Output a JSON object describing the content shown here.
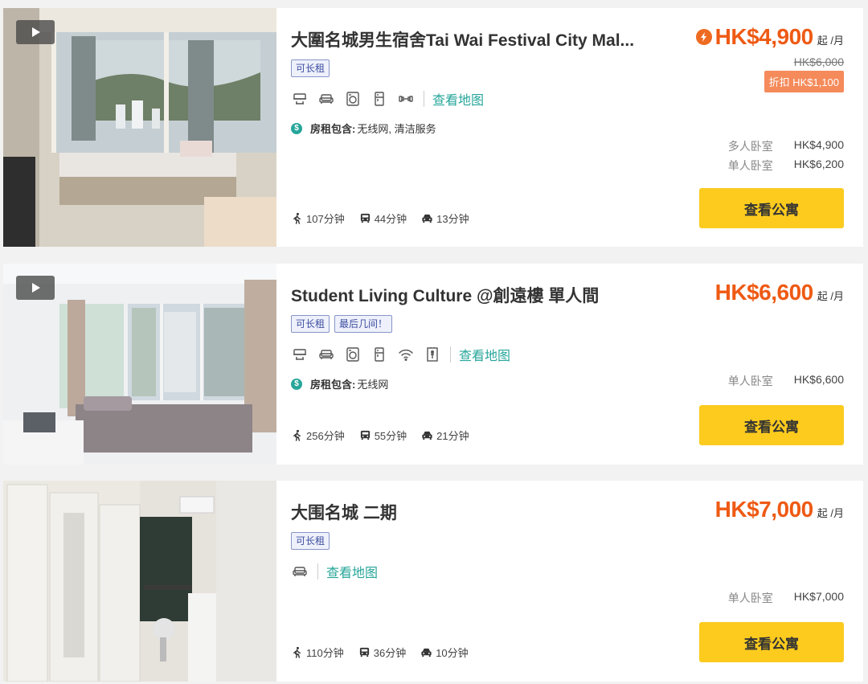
{
  "listings": [
    {
      "title": "大圍名城男生宿舍Tai Wai Festival City Mal...",
      "has_video": true,
      "tags": [
        "可长租"
      ],
      "amenities": [
        "cooker-hood-icon",
        "sofa-icon",
        "washing-machine-icon",
        "fridge-icon",
        "gym-icon"
      ],
      "map_link": "查看地图",
      "includes_label": "房租包含:",
      "includes_value": " 无线网, 清洁服务",
      "commute": {
        "walk": "107分钟",
        "bus": "44分钟",
        "car": "13分钟"
      },
      "flash_deal": true,
      "price": "HK$4,900",
      "price_suffix": "起 /月",
      "old_price": "HK$6,000",
      "discount": "折扣 HK$1,100",
      "rooms": [
        {
          "type": "多人卧室",
          "price": "HK$4,900"
        },
        {
          "type": "单人卧室",
          "price": "HK$6,200"
        }
      ],
      "button": "查看公寓"
    },
    {
      "title": "Student Living Culture @創遠樓 單人間",
      "has_video": true,
      "tags": [
        "可长租",
        "最后几间！"
      ],
      "amenities": [
        "cooker-hood-icon",
        "sofa-icon",
        "washing-machine-icon",
        "fridge-icon",
        "wifi-icon",
        "elevator-icon"
      ],
      "map_link": "查看地图",
      "includes_label": "房租包含:",
      "includes_value": " 无线网",
      "commute": {
        "walk": "256分钟",
        "bus": "55分钟",
        "car": "21分钟"
      },
      "flash_deal": false,
      "price": "HK$6,600",
      "price_suffix": "起 /月",
      "rooms": [
        {
          "type": "单人卧室",
          "price": "HK$6,600"
        }
      ],
      "button": "查看公寓"
    },
    {
      "title": "大围名城 二期",
      "has_video": false,
      "tags": [
        "可长租"
      ],
      "amenities": [
        "sofa-icon"
      ],
      "map_link": "查看地图",
      "commute": {
        "walk": "110分钟",
        "bus": "36分钟",
        "car": "10分钟"
      },
      "flash_deal": false,
      "price": "HK$7,000",
      "price_suffix": "起 /月",
      "rooms": [
        {
          "type": "单人卧室",
          "price": "HK$7,000"
        }
      ],
      "button": "查看公寓"
    }
  ],
  "colors": {
    "price": "#ee5a14",
    "accent_teal": "#27a69a",
    "button": "#fccb1e",
    "tag_border": "#8794c9",
    "discount_bg": "#f58a5a"
  }
}
